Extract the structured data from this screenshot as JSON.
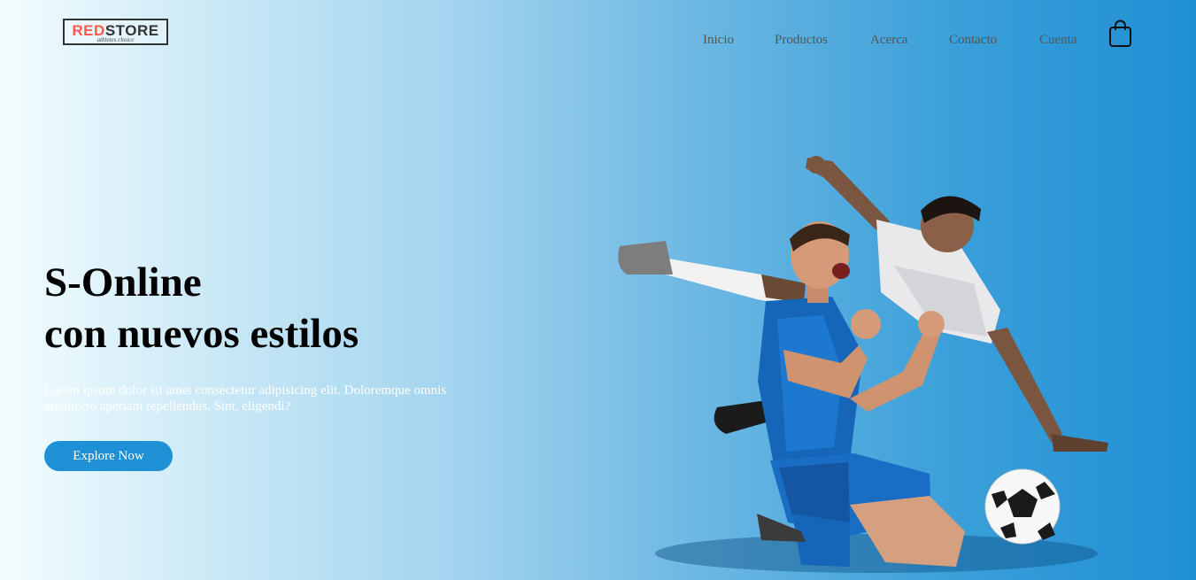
{
  "header": {
    "logo": {
      "brand_red": "RED",
      "brand_dark": "STORE",
      "tagline": "athletes choice"
    },
    "nav": [
      {
        "label": "Inicio"
      },
      {
        "label": "Productos"
      },
      {
        "label": "Acerca"
      },
      {
        "label": "Contacto"
      },
      {
        "label": "Cuenta"
      }
    ],
    "cart_icon": "shopping-bag-icon"
  },
  "hero": {
    "headline_line1": "S-Online",
    "headline_line2": "con nuevos estilos",
    "description": "Lorem ipsum dolor sit amet consectetur adipisicing elit. Doloremque omnis architecto aperiam repellendus. Sint, eligendi?",
    "cta_label": "Explore Now",
    "image": "two soccer players celebrating with a soccer ball"
  },
  "colors": {
    "accent": "#1e90d6",
    "logo_red": "#ff5a49",
    "gradient_start": "#f3fdff",
    "gradient_end": "#1f8fd4"
  }
}
